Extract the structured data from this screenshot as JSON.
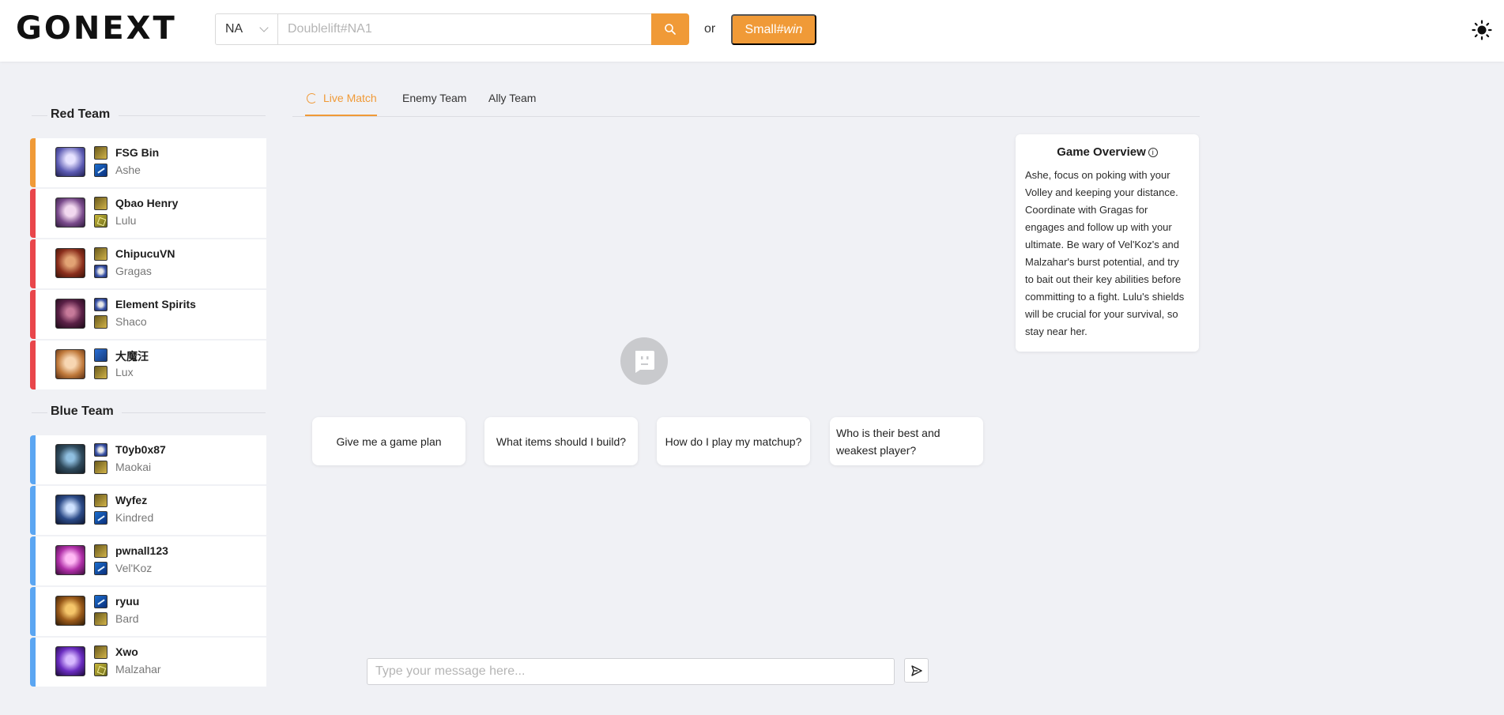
{
  "header": {
    "logo": "GONEXT",
    "region": "NA",
    "search_placeholder": "Doublelift#NA1",
    "or_text": "or",
    "win_button": {
      "prefix": "Small ",
      "suffix": "#win"
    },
    "accent_color": "#f09a37"
  },
  "sidebar": {
    "red_team": {
      "title": "Red Team",
      "players": [
        {
          "name": "FSG Bin",
          "champion": "Ashe",
          "bar_color": "#f09a37",
          "spells": [
            "ignite",
            "smite"
          ]
        },
        {
          "name": "Qbao Henry",
          "champion": "Lulu",
          "bar_color": "#e9464b",
          "spells": [
            "ignite",
            "heal"
          ]
        },
        {
          "name": "ChipucuVN",
          "champion": "Gragas",
          "bar_color": "#e9464b",
          "spells": [
            "ignite",
            "flash"
          ]
        },
        {
          "name": "Element Spirits",
          "champion": "Shaco",
          "bar_color": "#e9464b",
          "spells": [
            "flash",
            "ignite"
          ]
        },
        {
          "name": "大魔汪",
          "champion": "Lux",
          "bar_color": "#e9464b",
          "spells": [
            "tp",
            "ignite"
          ]
        }
      ]
    },
    "blue_team": {
      "title": "Blue Team",
      "players": [
        {
          "name": "T0yb0x87",
          "champion": "Maokai",
          "bar_color": "#5ba6f2",
          "spells": [
            "flash",
            "ignite"
          ]
        },
        {
          "name": "Wyfez",
          "champion": "Kindred",
          "bar_color": "#5ba6f2",
          "spells": [
            "ignite",
            "smite"
          ]
        },
        {
          "name": "pwnall123",
          "champion": "Vel'Koz",
          "bar_color": "#5ba6f2",
          "spells": [
            "ignite",
            "smite"
          ]
        },
        {
          "name": "ryuu",
          "champion": "Bard",
          "bar_color": "#5ba6f2",
          "spells": [
            "smite",
            "ignite"
          ]
        },
        {
          "name": "Xwo",
          "champion": "Malzahar",
          "bar_color": "#5ba6f2",
          "spells": [
            "ignite",
            "heal"
          ]
        }
      ]
    }
  },
  "tabs": [
    {
      "label": "Live Match",
      "active": true
    },
    {
      "label": "Enemy Team",
      "active": false
    },
    {
      "label": "Ally Team",
      "active": false
    }
  ],
  "overview": {
    "title": "Game Overview",
    "text": "Ashe, focus on poking with your Volley and keeping your distance. Coordinate with Gragas for engages and follow up with your ultimate. Be wary of Vel'Koz's and Malzahar's burst potential, and try to bait out their key abilities before committing to a fight. Lulu's shields will be crucial for your survival, so stay near her."
  },
  "suggestions": [
    "Give me a game plan",
    "What items should I build?",
    "How do I play my matchup?",
    "Who is their best and weakest player?"
  ],
  "chat": {
    "placeholder": "Type your message here..."
  }
}
